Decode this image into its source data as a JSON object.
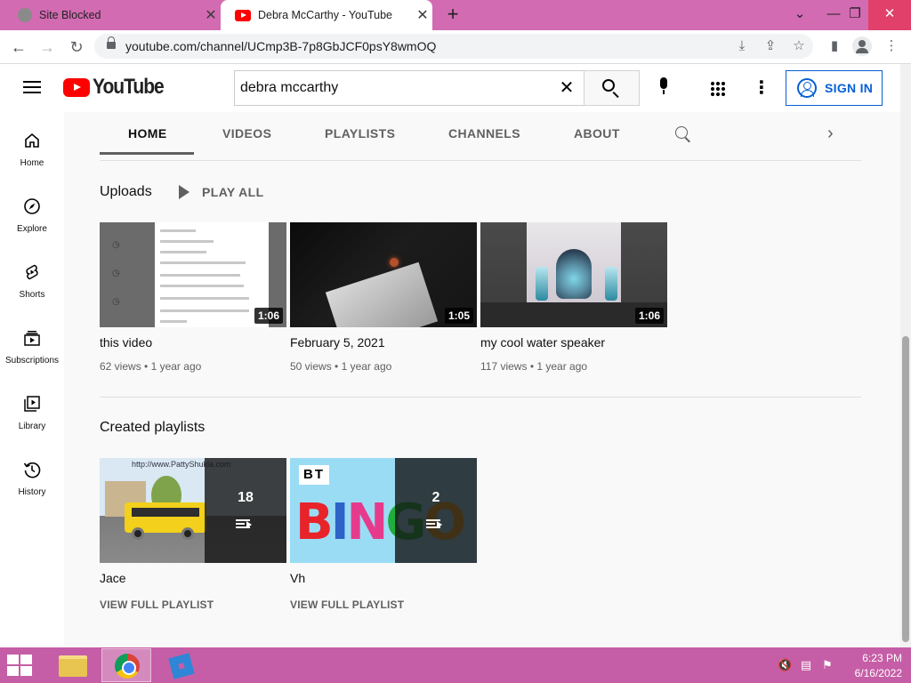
{
  "browser": {
    "tabs": [
      {
        "title": "Site Blocked",
        "close": "✕"
      },
      {
        "title": "Debra McCarthy - YouTube",
        "close": "✕"
      }
    ],
    "new_tab": "+",
    "url": "youtube.com/channel/UCmp3B-7p8GbJCF0psY8wmOQ",
    "nav": {
      "back": "←",
      "forward": "→",
      "reload": "↻"
    },
    "window_controls": {
      "dropdown": "⌄",
      "minimize": "—",
      "maximize": "❐",
      "close": "✕"
    },
    "icons": {
      "download": "⤓",
      "share": "⇪",
      "star": "☆",
      "side_panel": "▮",
      "menu": "⋮"
    }
  },
  "youtube": {
    "logo_text": "YouTube",
    "search": {
      "value": "debra mccarthy",
      "clear": "✕"
    },
    "more": "⋮",
    "sign_in": "SIGN IN",
    "guide": [
      {
        "label": "Home"
      },
      {
        "label": "Explore"
      },
      {
        "label": "Shorts"
      },
      {
        "label": "Subscriptions"
      },
      {
        "label": "Library"
      },
      {
        "label": "History"
      }
    ],
    "channel_tabs": [
      "HOME",
      "VIDEOS",
      "PLAYLISTS",
      "CHANNELS",
      "ABOUT"
    ],
    "next_arrow": "›",
    "uploads": {
      "title": "Uploads",
      "play_all": "PLAY ALL",
      "videos": [
        {
          "title": "this video",
          "duration": "1:06",
          "views": "62 views",
          "age": "1 year ago"
        },
        {
          "title": "February 5, 2021",
          "duration": "1:05",
          "views": "50 views",
          "age": "1 year ago"
        },
        {
          "title": "my cool water speaker",
          "duration": "1:06",
          "views": "117 views",
          "age": "1 year ago"
        }
      ],
      "thumb1_lines": [
        "base mega",
        "peppa pig song",
        "godzilla song",
        "peppa pig wash your hands song",
        "peppa pig wash your hands",
        "peppa pig wash your hands",
        "do not join this chat room at night",
        "do not join this online chat room at night",
        "ghosts fired"
      ]
    },
    "playlists": {
      "title": "Created playlists",
      "items": [
        {
          "title": "Jace",
          "count": "18",
          "link": "VIEW FULL PLAYLIST",
          "thumb_text": "http://www.PattyShukla.com"
        },
        {
          "title": "Vh",
          "count": "2",
          "link": "VIEW FULL PLAYLIST",
          "thumb_text": "BT",
          "bingo": "BINGO"
        }
      ]
    },
    "meta_separator": "•"
  },
  "taskbar": {
    "time": "6:23 PM",
    "date": "6/16/2022"
  },
  "colors": {
    "tabstrip": "#d36bb2",
    "taskbar": "#c55ea6",
    "yt_red": "#ff0000",
    "link_blue": "#065fd4"
  }
}
